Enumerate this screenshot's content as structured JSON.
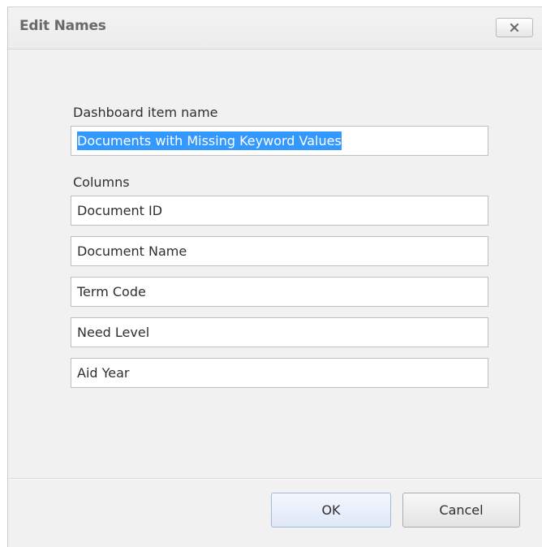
{
  "dialog": {
    "title": "Edit Names",
    "close_icon": "close-icon"
  },
  "form": {
    "item_name_label": "Dashboard item name",
    "item_name_value": "Documents with Missing Keyword Values",
    "columns_label": "Columns",
    "columns": [
      "Document ID",
      "Document Name",
      "Term Code",
      "Need Level",
      "Aid Year"
    ]
  },
  "buttons": {
    "ok": "OK",
    "cancel": "Cancel"
  }
}
